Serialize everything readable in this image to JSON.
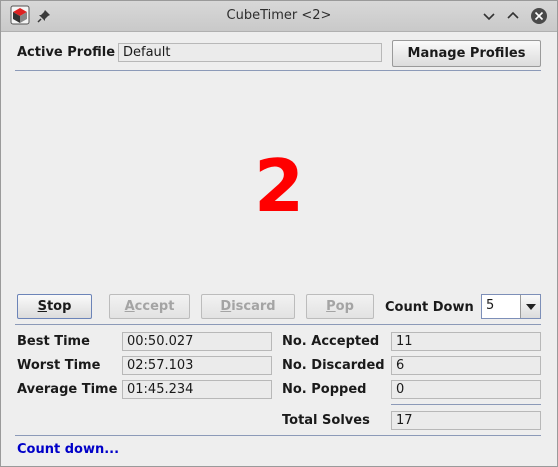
{
  "window": {
    "title": "CubeTimer <2>"
  },
  "profile": {
    "label": "Active Profile",
    "value": "Default",
    "manage_label": "Manage Profiles"
  },
  "display": {
    "countdown_value": "2"
  },
  "buttons": {
    "stop": {
      "mnemonic": "S",
      "rest": "top"
    },
    "accept": {
      "mnemonic": "A",
      "rest": "ccept"
    },
    "discard": {
      "mnemonic": "D",
      "rest": "iscard"
    },
    "pop": {
      "mnemonic": "P",
      "rest": "op"
    }
  },
  "countdown": {
    "label": "Count Down",
    "selected": "5"
  },
  "stats_left": [
    {
      "label": "Best Time",
      "value": "00:50.027"
    },
    {
      "label": "Worst Time",
      "value": "02:57.103"
    },
    {
      "label": "Average Time",
      "value": "01:45.234"
    }
  ],
  "stats_right": [
    {
      "label": "No. Accepted",
      "value": "11"
    },
    {
      "label": "No. Discarded",
      "value": "6"
    },
    {
      "label": "No. Popped",
      "value": "0"
    }
  ],
  "total": {
    "label": "Total Solves",
    "value": "17"
  },
  "status": {
    "text": "Count down..."
  },
  "colors": {
    "countdown": "#ff0000",
    "status": "#0000c8",
    "separator": "#8c9ab8"
  },
  "icons": {
    "app": "cube-app-icon",
    "pin": "pin-icon",
    "minimize": "chevron-down-icon",
    "maximize": "chevron-up-icon",
    "close": "close-icon"
  }
}
